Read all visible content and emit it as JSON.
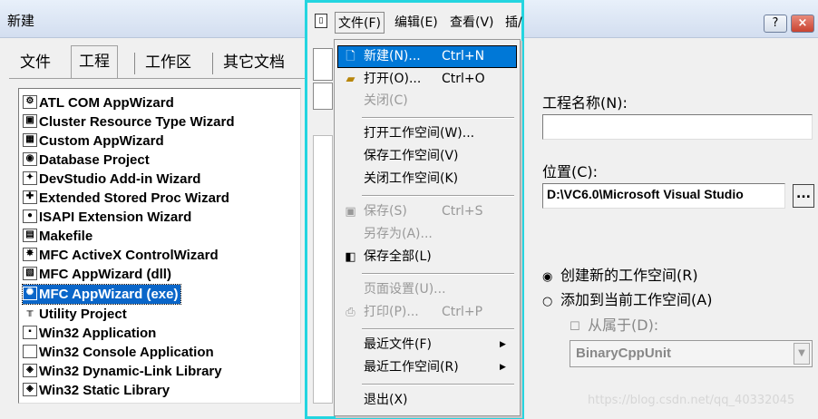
{
  "window": {
    "title": "新建",
    "help_label": "?",
    "close_label": "×"
  },
  "tabs": [
    "文件",
    "工程",
    "工作区",
    "其它文档"
  ],
  "projects": [
    {
      "label": "ATL COM AppWizard",
      "icon": "atl-icon"
    },
    {
      "label": "Cluster Resource Type Wizard",
      "icon": "cluster-icon"
    },
    {
      "label": "Custom AppWizard",
      "icon": "custom-icon"
    },
    {
      "label": "Database Project",
      "icon": "database-icon"
    },
    {
      "label": "DevStudio Add-in Wizard",
      "icon": "addin-icon"
    },
    {
      "label": "Extended Stored Proc Wizard",
      "icon": "proc-icon"
    },
    {
      "label": "ISAPI Extension Wizard",
      "icon": "globe-icon"
    },
    {
      "label": "Makefile",
      "icon": "makefile-icon"
    },
    {
      "label": "MFC ActiveX ControlWizard",
      "icon": "activex-icon"
    },
    {
      "label": "MFC AppWizard (dll)",
      "icon": "mfc-dll-icon"
    },
    {
      "label": "MFC AppWizard (exe)",
      "icon": "mfc-exe-icon",
      "selected": true
    },
    {
      "label": "Utility Project",
      "icon": "utility-icon"
    },
    {
      "label": "Win32 Application",
      "icon": "win32-app-icon"
    },
    {
      "label": "Win32 Console Application",
      "icon": "console-icon"
    },
    {
      "label": "Win32 Dynamic-Link Library",
      "icon": "dll-icon"
    },
    {
      "label": "Win32 Static Library",
      "icon": "lib-icon"
    }
  ],
  "menubar": [
    "文件(F)",
    "编辑(E)",
    "查看(V)",
    "插/"
  ],
  "file_menu": [
    {
      "label": "新建(N)...",
      "shortcut": "Ctrl+N",
      "icon": "new-file-icon",
      "highlight": true
    },
    {
      "label": "打开(O)...",
      "shortcut": "Ctrl+O",
      "icon": "open-folder-icon"
    },
    {
      "label": "关闭(C)",
      "disabled": true
    },
    {
      "sep": true
    },
    {
      "label": "打开工作空间(W)..."
    },
    {
      "label": "保存工作空间(V)"
    },
    {
      "label": "关闭工作空间(K)"
    },
    {
      "sep": true
    },
    {
      "label": "保存(S)",
      "shortcut": "Ctrl+S",
      "icon": "save-icon",
      "disabled": true
    },
    {
      "label": "另存为(A)...",
      "disabled": true
    },
    {
      "label": "保存全部(L)",
      "icon": "save-all-icon"
    },
    {
      "sep": true
    },
    {
      "label": "页面设置(U)...",
      "disabled": true
    },
    {
      "label": "打印(P)...",
      "shortcut": "Ctrl+P",
      "icon": "print-icon",
      "disabled": true
    },
    {
      "sep": true
    },
    {
      "label": "最近文件(F)",
      "submenu": true
    },
    {
      "label": "最近工作空间(R)",
      "submenu": true
    },
    {
      "sep": true
    },
    {
      "label": "退出(X)"
    }
  ],
  "right": {
    "name_label": "工程名称(N):",
    "name_value": "",
    "loc_label": "位置(C):",
    "loc_value": "D:\\VC6.0\\Microsoft Visual Studio",
    "browse_label": "...",
    "radio_new": "创建新的工作空间(R)",
    "radio_add": "添加到当前工作空间(A)",
    "dep_label": "从属于(D):",
    "dep_value": "BinaryCppUnit"
  },
  "watermark": "https://blog.csdn.net/qq_40332045",
  "colors": {
    "selection": "#0a66c9",
    "menu_highlight": "#0078d7",
    "frame": "#24d5e0"
  }
}
